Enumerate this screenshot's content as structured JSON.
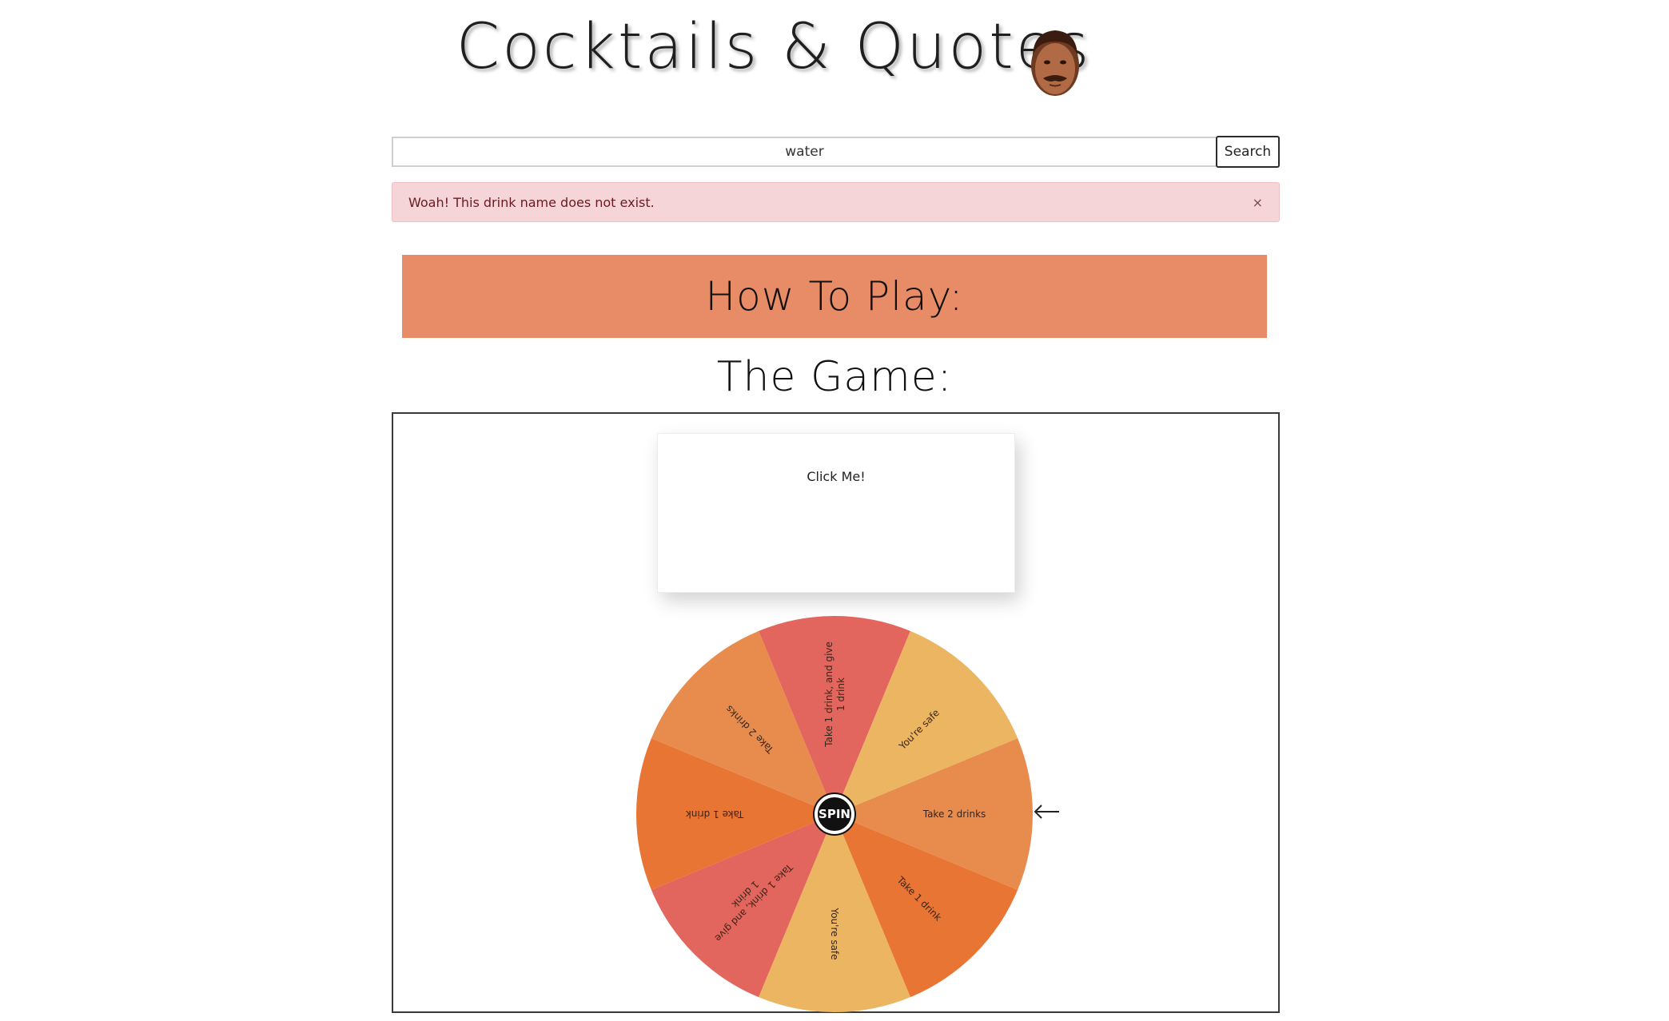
{
  "header": {
    "title": "Cocktails & Quotes",
    "avatar_icon": "man-face-icon"
  },
  "search": {
    "value": "water",
    "placeholder": "",
    "button_label": "Search"
  },
  "alert": {
    "message": "Woah! This drink name does not exist.",
    "close_label": "×"
  },
  "howto": {
    "title": "How To Play:",
    "background_color": "#e88b67"
  },
  "game": {
    "title": "The Game:",
    "card_label": "Click Me!",
    "spin_label": "SPIN",
    "pointer_icon": "arrow-left-icon",
    "wheel": {
      "segments": [
        {
          "label": "Take 2 drinks",
          "color": "#e88c4e"
        },
        {
          "label": "Take 1 drink",
          "color": "#e87533"
        },
        {
          "label": "You're safe",
          "color": "#ebb562"
        },
        {
          "label": "Take 1 drink, and give 1 drink",
          "color": "#e2665d"
        },
        {
          "label": "Take 1 drink",
          "color": "#e87533"
        },
        {
          "label": "Take 2 drinks",
          "color": "#e88c4e"
        },
        {
          "label": "Take 1 drink, and give 1 drink",
          "color": "#e2665d"
        },
        {
          "label": "You're safe",
          "color": "#ebb562"
        }
      ]
    }
  }
}
